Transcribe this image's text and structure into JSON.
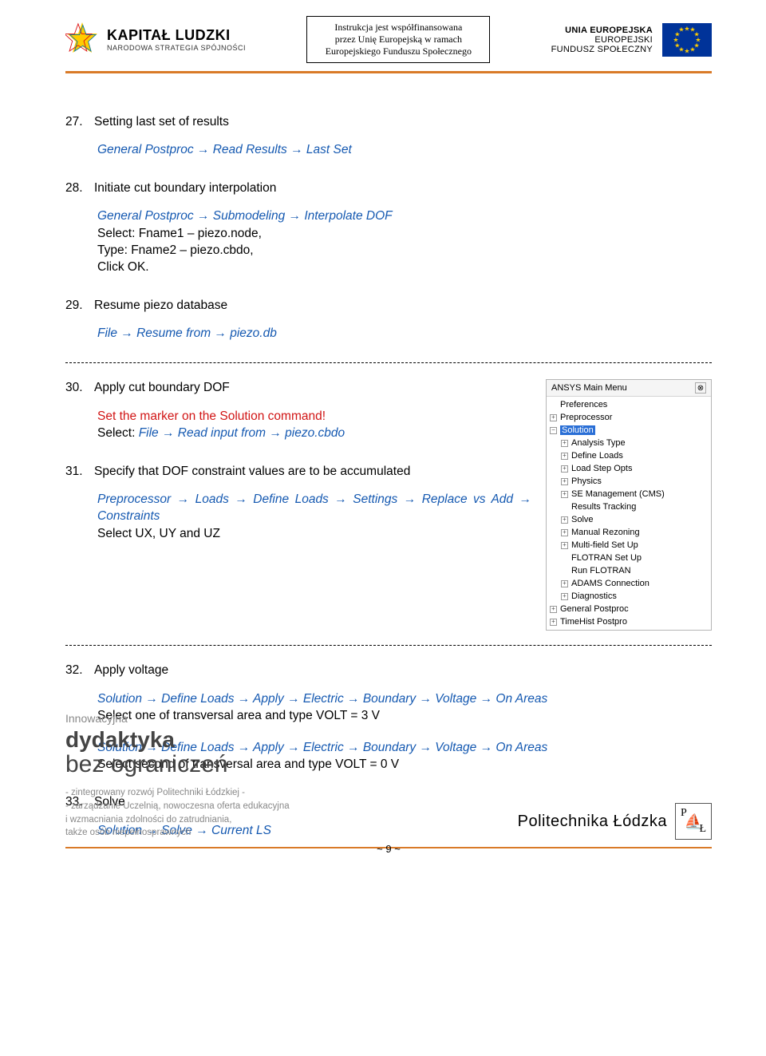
{
  "header": {
    "left_title": "KAPITAŁ LUDZKI",
    "left_sub": "NARODOWA STRATEGIA SPÓJNOŚCI",
    "center_line1": "Instrukcja jest współfinansowana",
    "center_line2": "przez Unię Europejską w ramach",
    "center_line3": "Europejskiego Funduszu Społecznego",
    "right_line1": "UNIA EUROPEJSKA",
    "right_line2": "EUROPEJSKI",
    "right_line3": "FUNDUSZ SPOŁECZNY"
  },
  "s27": {
    "num": "27.",
    "title": "Setting last set of results",
    "path": "General Postproc → Read Results → Last Set"
  },
  "s28": {
    "num": "28.",
    "title": "Initiate cut boundary interpolation",
    "path": "General Postproc → Submodeling → Interpolate DOF",
    "l1": "Select: Fname1 – piezo.node,",
    "l2": "Type: Fname2 – piezo.cbdo,",
    "l3": "Click OK."
  },
  "s29": {
    "num": "29.",
    "title": "Resume piezo database",
    "path": "File → Resume from → piezo.db"
  },
  "s30": {
    "num": "30.",
    "title": "Apply cut boundary DOF",
    "red": "Set the marker on the Solution command!",
    "l1a": "Select: ",
    "l1b": "File → Read input from → piezo.cbdo"
  },
  "s31": {
    "num": "31.",
    "title": "Specify that DOF constraint values are to be accumulated",
    "path": "Preprocessor → Loads → Define Loads → Settings → Replace vs Add → Constraints",
    "l1": "Select UX, UY and UZ"
  },
  "s32": {
    "num": "32.",
    "title": "Apply voltage",
    "path1": "Solution → Define Loads → Apply → Electric → Boundary → Voltage → On Areas",
    "l1": "Select one of transversal area and type VOLT = 3 V",
    "path2": "Solution → Define Loads → Apply → Electric → Boundary → Voltage → On Areas",
    "l2": "Select second of transversal area and type VOLT = 0 V"
  },
  "s33": {
    "num": "33.",
    "title": "Solve",
    "path": "Solution → Solve → Current LS"
  },
  "menu": {
    "title": "ANSYS Main Menu",
    "items": [
      {
        "lvl": 1,
        "pm": "",
        "label": "Preferences",
        "plain": true
      },
      {
        "lvl": 1,
        "pm": "+",
        "label": "Preprocessor"
      },
      {
        "lvl": 1,
        "pm": "−",
        "label": "Solution",
        "sel": true
      },
      {
        "lvl": 2,
        "pm": "+",
        "label": "Analysis Type"
      },
      {
        "lvl": 2,
        "pm": "+",
        "label": "Define Loads"
      },
      {
        "lvl": 2,
        "pm": "+",
        "label": "Load Step Opts"
      },
      {
        "lvl": 2,
        "pm": "+",
        "label": "Physics"
      },
      {
        "lvl": 2,
        "pm": "+",
        "label": "SE Management (CMS)"
      },
      {
        "lvl": 2,
        "pm": "",
        "label": "Results Tracking",
        "plain": true
      },
      {
        "lvl": 2,
        "pm": "+",
        "label": "Solve"
      },
      {
        "lvl": 2,
        "pm": "+",
        "label": "Manual Rezoning"
      },
      {
        "lvl": 2,
        "pm": "+",
        "label": "Multi-field Set Up"
      },
      {
        "lvl": 2,
        "pm": "",
        "label": "FLOTRAN Set Up",
        "plain": true
      },
      {
        "lvl": 2,
        "pm": "",
        "label": "Run FLOTRAN",
        "plain": true
      },
      {
        "lvl": 2,
        "pm": "+",
        "label": "ADAMS Connection"
      },
      {
        "lvl": 2,
        "pm": "+",
        "label": "Diagnostics"
      },
      {
        "lvl": 1,
        "pm": "+",
        "label": "General Postproc"
      },
      {
        "lvl": 1,
        "pm": "+",
        "label": "TimeHist Postpro"
      }
    ]
  },
  "footer": {
    "w1": "Innowacyjna",
    "w2": "dydaktyka",
    "w3": "bez ograniczeń",
    "f1": "- zintegrowany rozwój Politechniki Łódzkiej -",
    "f2": "- zarządzanie Uczelnią,  nowoczesna oferta edukacyjna",
    "f3": "i wzmacniania zdolności do zatrudniania,",
    "f4": "także osób niepełnosprawnych",
    "pl": "Politechnika Łódzka",
    "pagenum": "~ 9 ~"
  }
}
